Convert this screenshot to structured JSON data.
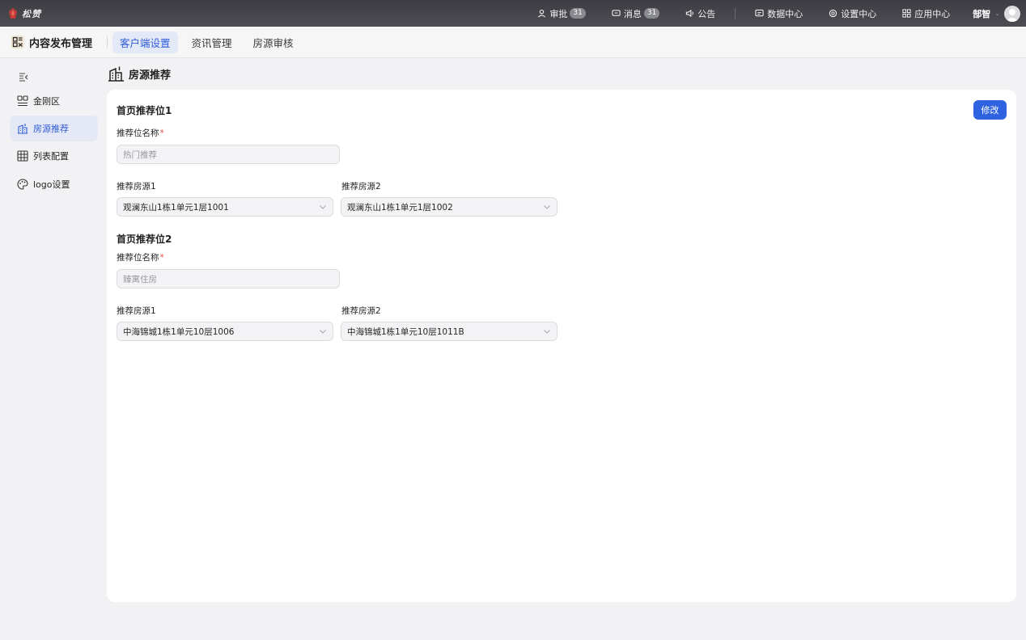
{
  "topbar": {
    "brand": "松赞",
    "approval": {
      "label": "审批",
      "count": "31"
    },
    "messages": {
      "label": "消息",
      "count": "31"
    },
    "notice": "公告",
    "data_center": "数据中心",
    "settings_center": "设置中心",
    "app_center": "应用中心",
    "user": "郜智"
  },
  "module": {
    "title": "内容发布管理",
    "tabs": [
      {
        "label": "客户端设置",
        "active": true
      },
      {
        "label": "资讯管理"
      },
      {
        "label": "房源审核"
      }
    ]
  },
  "sidebar": {
    "items": [
      {
        "label": "金刚区",
        "icon": "grid-icon"
      },
      {
        "label": "房源推荐",
        "icon": "building-icon",
        "active": true
      },
      {
        "label": "列表配置",
        "icon": "table-icon"
      },
      {
        "label": "logo设置",
        "icon": "palette-icon"
      }
    ]
  },
  "page": {
    "title": "房源推荐",
    "edit_button": "修改",
    "slot1": {
      "title": "首页推荐位1",
      "name_label": "推荐位名称",
      "name_value": "热门推荐",
      "house1_label": "推荐房源1",
      "house1_value": "观澜东山1栋1单元1层1001",
      "house2_label": "推荐房源2",
      "house2_value": "观澜东山1栋1单元1层1002"
    },
    "slot2": {
      "title": "首页推荐位2",
      "name_label": "推荐位名称",
      "name_value": "臻寓住房",
      "house1_label": "推荐房源1",
      "house1_value": "中海锦城1栋1单元10层1006",
      "house2_label": "推荐房源2",
      "house2_value": "中海锦城1栋1单元10层1011B"
    }
  },
  "colors": {
    "accent": "#2f62e0",
    "required": "#e5484d",
    "topbar": "#46474c"
  }
}
